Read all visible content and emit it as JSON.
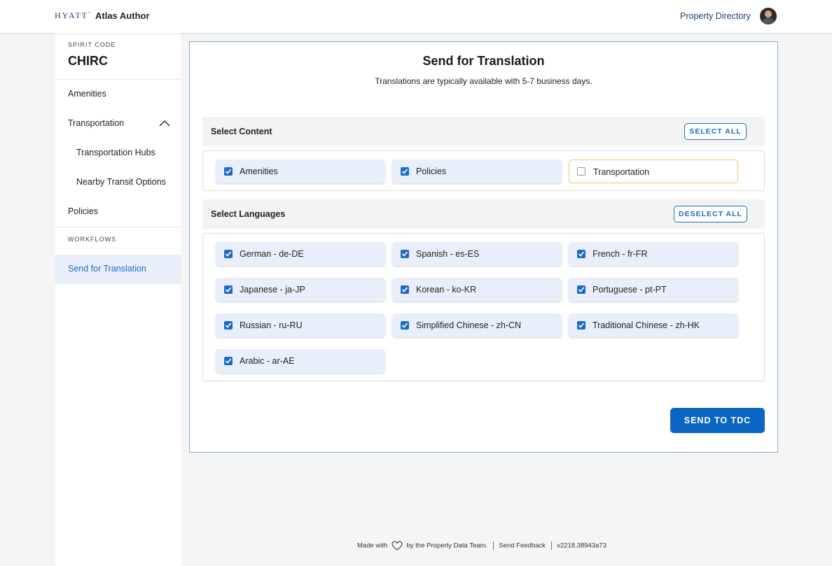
{
  "header": {
    "logo_text": "HYATT",
    "app_title": "Atlas Author",
    "property_directory": "Property Directory"
  },
  "sidebar": {
    "spirit_code_label": "SPIRIT CODE",
    "spirit_code": "CHIRC",
    "items": [
      {
        "label": "Amenities"
      },
      {
        "label": "Transportation",
        "expanded": true
      },
      {
        "label": "Transportation Hubs"
      },
      {
        "label": "Nearby Transit Options"
      },
      {
        "label": "Policies"
      }
    ],
    "workflows_label": "WORKFLOWS",
    "active_item": "Send for Translation"
  },
  "main": {
    "title": "Send for Translation",
    "subtitle": "Translations are typically available with 5-7 business days.",
    "select_content": {
      "label": "Select Content",
      "button": "SELECT ALL",
      "options": [
        {
          "label": "Amenities",
          "checked": true
        },
        {
          "label": "Policies",
          "checked": true
        },
        {
          "label": "Transportation",
          "checked": false
        }
      ]
    },
    "select_languages": {
      "label": "Select Languages",
      "button": "DESELECT ALL",
      "options": [
        {
          "label": "German - de-DE",
          "checked": true
        },
        {
          "label": "Spanish - es-ES",
          "checked": true
        },
        {
          "label": "French - fr-FR",
          "checked": true
        },
        {
          "label": "Japanese - ja-JP",
          "checked": true
        },
        {
          "label": "Korean - ko-KR",
          "checked": true
        },
        {
          "label": "Portuguese - pt-PT",
          "checked": true
        },
        {
          "label": "Russian - ru-RU",
          "checked": true
        },
        {
          "label": "Simplified Chinese - zh-CN",
          "checked": true
        },
        {
          "label": "Traditional Chinese - zh-HK",
          "checked": true
        },
        {
          "label": "Arabic - ar-AE",
          "checked": true
        }
      ]
    },
    "submit_button": "SEND TO TDC"
  },
  "footer": {
    "made_with": "Made with",
    "by_team": "by the Property Data Team.",
    "send_feedback": "Send Feedback",
    "version": "v2218.38943a73"
  },
  "colors": {
    "accent": "#1f6bc4",
    "primary_button": "#0b65c2",
    "chip_background": "#e8effa",
    "unchecked_border": "#f2c46b"
  }
}
